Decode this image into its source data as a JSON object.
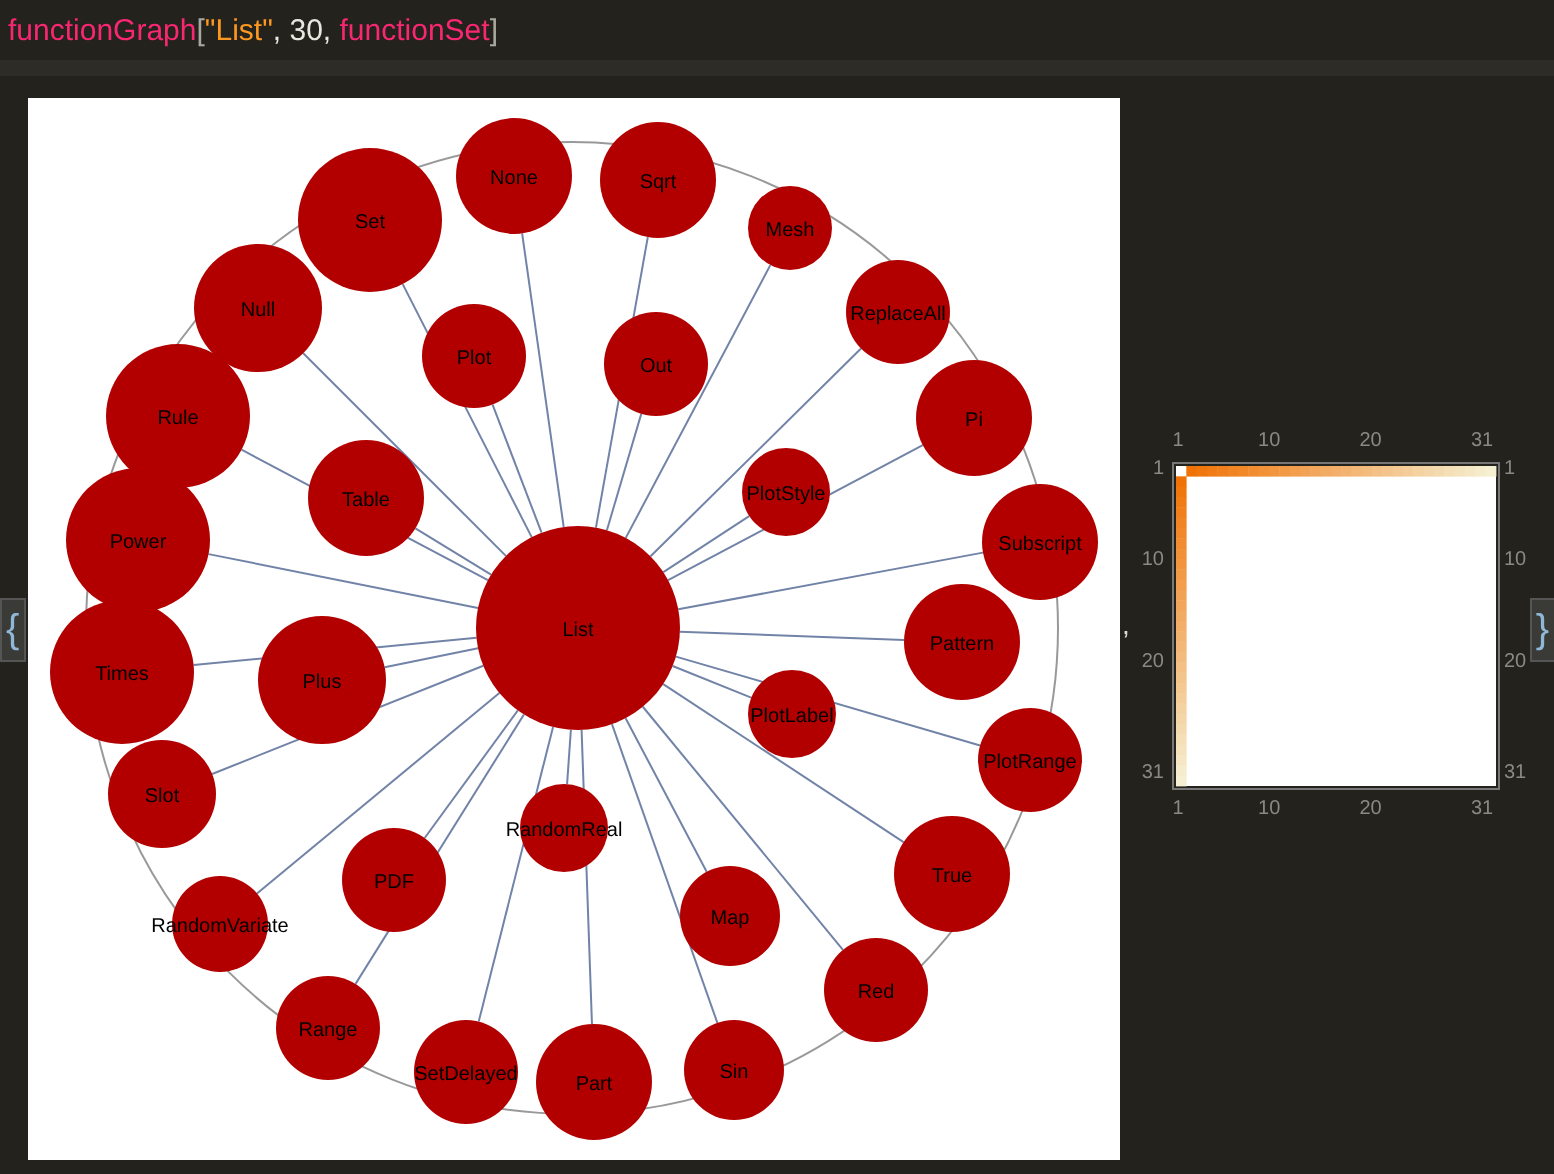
{
  "input": {
    "tokens": [
      {
        "kind": "function",
        "text": "functionGraph"
      },
      {
        "kind": "bracket",
        "text": "["
      },
      {
        "kind": "string",
        "text": "\"List\""
      },
      {
        "kind": "plain",
        "text": ", 30, "
      },
      {
        "kind": "function",
        "text": "functionSet"
      },
      {
        "kind": "bracket",
        "text": "]"
      }
    ]
  },
  "output": {
    "open_brace": "{",
    "separator": ",",
    "close_brace": "}",
    "graph": {
      "nodes": [
        {
          "label": "List"
        },
        {
          "label": "Set"
        },
        {
          "label": "None"
        },
        {
          "label": "Sqrt"
        },
        {
          "label": "Mesh"
        },
        {
          "label": "ReplaceAll"
        },
        {
          "label": "Pi"
        },
        {
          "label": "Subscript"
        },
        {
          "label": "Pattern"
        },
        {
          "label": "PlotRange"
        },
        {
          "label": "True"
        },
        {
          "label": "Red"
        },
        {
          "label": "Sin"
        },
        {
          "label": "Part"
        },
        {
          "label": "SetDelayed"
        },
        {
          "label": "Range"
        },
        {
          "label": "Slot"
        },
        {
          "label": "RandomVariate"
        },
        {
          "label": "Times"
        },
        {
          "label": "Power"
        },
        {
          "label": "Rule"
        },
        {
          "label": "Null"
        },
        {
          "label": "Table"
        },
        {
          "label": "Plot"
        },
        {
          "label": "Out"
        },
        {
          "label": "PlotStyle"
        },
        {
          "label": "PlotLabel"
        },
        {
          "label": "Map"
        },
        {
          "label": "RandomReal"
        },
        {
          "label": "PDF"
        },
        {
          "label": "Plus"
        }
      ]
    },
    "matrix_plot": {
      "top_ticks": [
        "1",
        "10",
        "20",
        "31"
      ],
      "bottom_ticks": [
        "1",
        "10",
        "20",
        "31"
      ],
      "left_ticks": [
        "1",
        "10",
        "20",
        "31"
      ],
      "right_ticks": [
        "1",
        "10",
        "20",
        "31"
      ]
    }
  }
}
